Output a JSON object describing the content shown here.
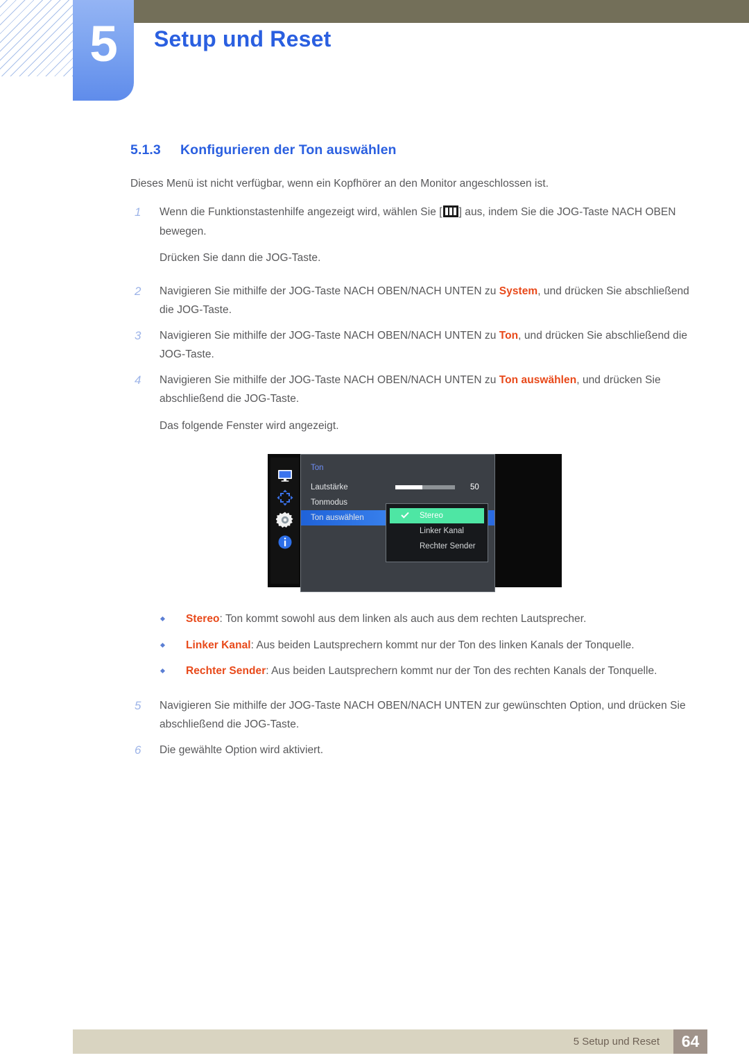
{
  "header": {
    "chapter_number": "5",
    "chapter_title": "Setup und Reset"
  },
  "section": {
    "number": "5.1.3",
    "title": "Konfigurieren der Ton auswählen"
  },
  "intro": "Dieses Menü ist nicht verfügbar, wenn ein Kopfhörer an den Monitor angeschlossen ist.",
  "steps": [
    {
      "num": "1",
      "text_before": "Wenn die Funktionstastenhilfe angezeigt wird, wählen Sie [",
      "icon": "menu-bars-icon",
      "text_after": "] aus, indem Sie die JOG-Taste NACH OBEN bewegen.",
      "sub": "Drücken Sie dann die JOG-Taste."
    },
    {
      "num": "2",
      "text_before": "Navigieren Sie mithilfe der JOG-Taste NACH OBEN/NACH UNTEN zu ",
      "highlight": "System",
      "text_after": ", und drücken Sie abschließend die JOG-Taste."
    },
    {
      "num": "3",
      "text_before": "Navigieren Sie mithilfe der JOG-Taste NACH OBEN/NACH UNTEN zu ",
      "highlight": "Ton",
      "text_after": ", und drücken Sie abschließend die JOG-Taste."
    },
    {
      "num": "4",
      "text_before": "Navigieren Sie mithilfe der JOG-Taste NACH OBEN/NACH UNTEN zu ",
      "highlight": "Ton auswählen",
      "text_after": ", und drücken Sie abschließend die JOG-Taste.",
      "sub": "Das folgende Fenster wird angezeigt."
    },
    {
      "num": "5",
      "text_before": "Navigieren Sie mithilfe der JOG-Taste NACH OBEN/NACH UNTEN zur gewünschten Option, und drücken Sie abschließend die JOG-Taste."
    },
    {
      "num": "6",
      "text_before": "Die gewählte Option wird aktiviert."
    }
  ],
  "osd": {
    "title": "Ton",
    "sidebar_icons": [
      "monitor-icon",
      "move-arrows-icon",
      "gear-icon",
      "info-icon"
    ],
    "rows": [
      {
        "label": "Lautstärke",
        "value": "50",
        "slider_percent": 45
      },
      {
        "label": "Tonmodus",
        "value": ""
      },
      {
        "label": "Ton auswählen",
        "value": "",
        "selected": true
      }
    ],
    "submenu": [
      {
        "label": "Stereo",
        "checked": true
      },
      {
        "label": "Linker Kanal",
        "checked": false
      },
      {
        "label": "Rechter Sender",
        "checked": false
      }
    ],
    "colors": {
      "selected_row": "#2a6ae0",
      "submenu_selected": "#4ee6a4",
      "panel_bg": "#3b3f45",
      "title": "#6e8ef5"
    }
  },
  "bullets": [
    {
      "term": "Stereo",
      "desc": ": Ton kommt sowohl aus dem linken als auch aus dem rechten Lautsprecher."
    },
    {
      "term": "Linker Kanal",
      "desc": ": Aus beiden Lautsprechern kommt nur der Ton des linken Kanals der Tonquelle."
    },
    {
      "term": "Rechter Sender",
      "desc": ": Aus beiden Lautsprechern kommt nur der Ton des rechten Kanals der Tonquelle."
    }
  ],
  "footer": {
    "text": "5 Setup und Reset",
    "page": "64"
  },
  "theme": {
    "accent_blue": "#2a5fe0",
    "highlight_orange": "#e8491a",
    "olive": "#736f59",
    "footer_beige": "#d9d4c1",
    "footer_brown": "#a0938a"
  }
}
